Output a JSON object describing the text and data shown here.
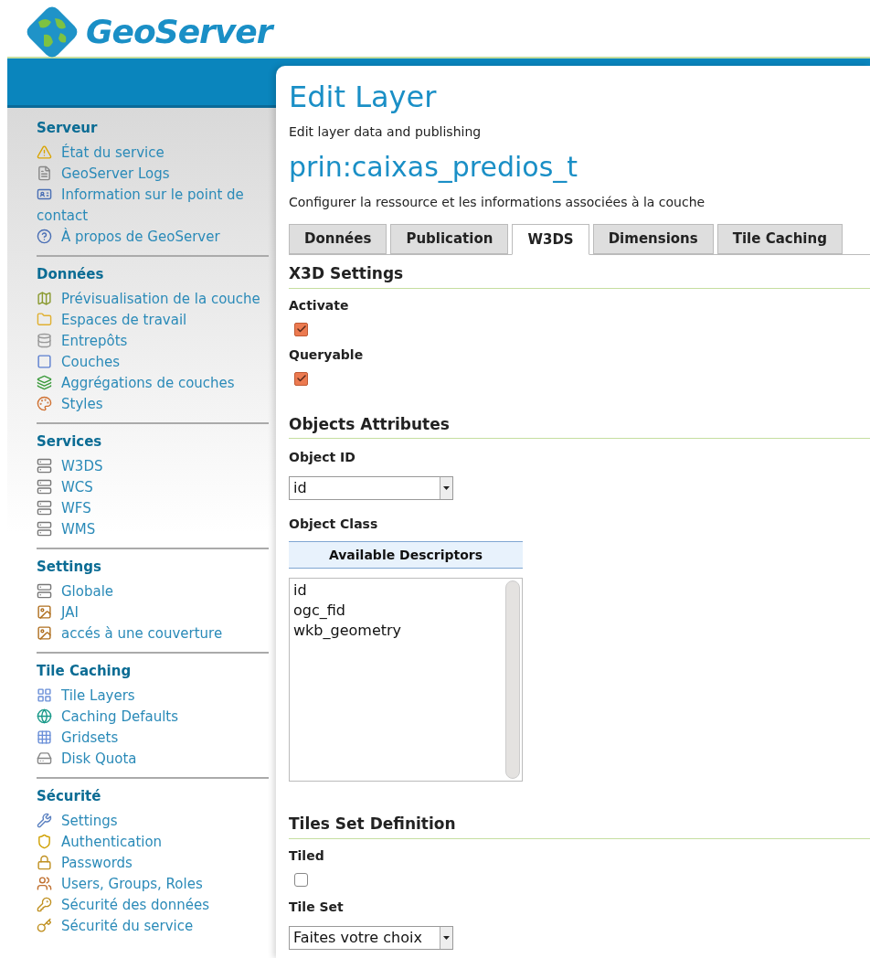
{
  "logo": {
    "text": "GeoServer"
  },
  "sidebar": {
    "sections": [
      {
        "title": "Serveur",
        "items": [
          "État du service",
          "GeoServer Logs",
          "Information sur le point de contact",
          "À propos de GeoServer"
        ]
      },
      {
        "title": "Données",
        "items": [
          "Prévisualisation de la couche",
          "Espaces de travail",
          "Entrepôts",
          "Couches",
          "Aggrégations de couches",
          "Styles"
        ]
      },
      {
        "title": "Services",
        "items": [
          "W3DS",
          "WCS",
          "WFS",
          "WMS"
        ]
      },
      {
        "title": "Settings",
        "items": [
          "Globale",
          "JAI",
          "accés à une couverture"
        ]
      },
      {
        "title": "Tile Caching",
        "items": [
          "Tile Layers",
          "Caching Defaults",
          "Gridsets",
          "Disk Quota"
        ]
      },
      {
        "title": "Sécurité",
        "items": [
          "Settings",
          "Authentication",
          "Passwords",
          "Users, Groups, Roles",
          "Sécurité des données",
          "Sécurité du service"
        ]
      }
    ]
  },
  "page": {
    "title": "Edit Layer",
    "subtitle": "Edit layer data and publishing",
    "layer_name": "prin:caixas_predios_t",
    "description": "Configurer la ressource et les informations associées à la couche"
  },
  "tabs": [
    {
      "label": "Données",
      "selected": false
    },
    {
      "label": "Publication",
      "selected": false
    },
    {
      "label": "W3DS",
      "selected": true
    },
    {
      "label": "Dimensions",
      "selected": false
    },
    {
      "label": "Tile Caching",
      "selected": false
    }
  ],
  "sections": [
    {
      "title": "X3D Settings",
      "fields": [
        {
          "kind": "checkbox",
          "label": "Activate",
          "checked": true
        },
        {
          "kind": "checkbox",
          "label": "Queryable",
          "checked": true
        }
      ]
    },
    {
      "title": "Objects Attributes",
      "fields": [
        {
          "kind": "select",
          "label": "Object ID",
          "value": "id"
        },
        {
          "kind": "listbox",
          "label": "Object Class",
          "header": "Available Descriptors",
          "options": [
            "id",
            "ogc_fid",
            "wkb_geometry"
          ]
        }
      ]
    },
    {
      "title": "Tiles Set Definition",
      "fields": [
        {
          "kind": "checkbox",
          "label": "Tiled",
          "checked": false
        },
        {
          "kind": "select",
          "label": "Tile Set",
          "value": "Faites votre choix"
        }
      ]
    }
  ]
}
